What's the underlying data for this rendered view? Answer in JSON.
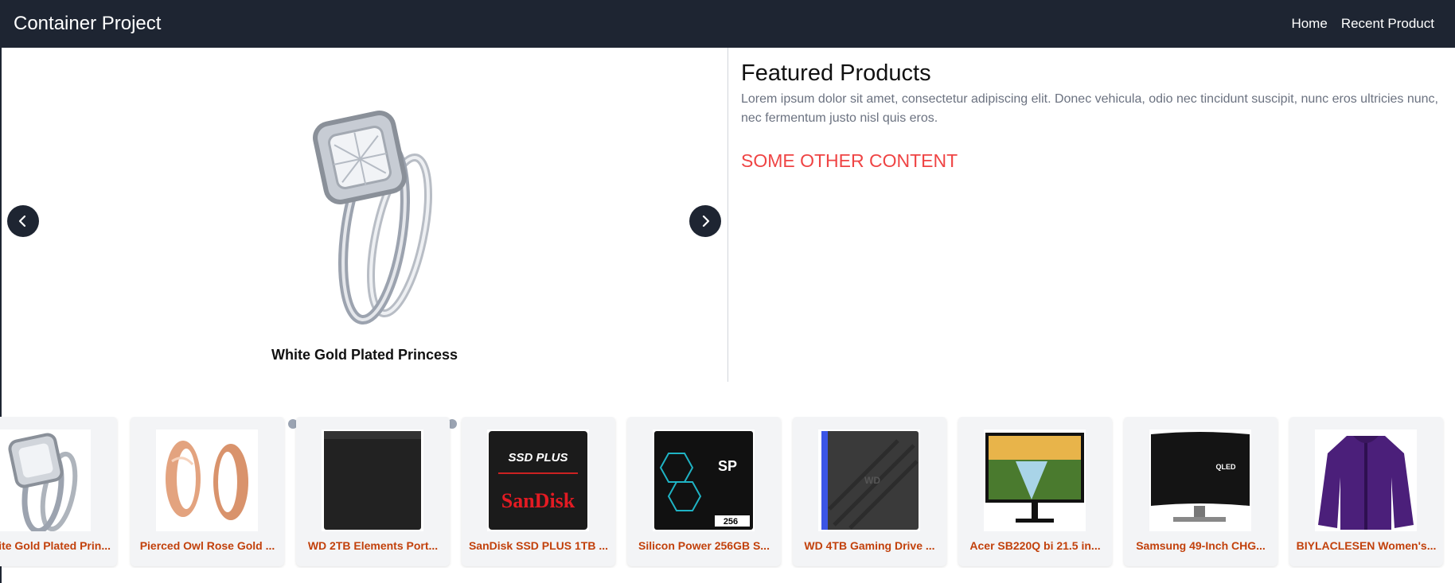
{
  "navbar": {
    "brand": "Container Project",
    "links": [
      "Home",
      "Recent Product"
    ]
  },
  "carousel": {
    "title": "White Gold Plated Princess",
    "dot_count": 20,
    "active_dot": 6
  },
  "featured": {
    "title": "Featured Products",
    "text": "Lorem ipsum dolor sit amet, consectetur adipiscing elit. Donec vehicula, odio nec tincidunt suscipit, nunc eros ultricies nunc, nec fermentum justo nisl quis eros.",
    "other": "SOME OTHER CONTENT"
  },
  "products": [
    "White Gold Plated Prin...",
    "Pierced Owl Rose Gold ...",
    "WD 2TB Elements Port...",
    "SanDisk SSD PLUS 1TB ...",
    "Silicon Power 256GB S...",
    "WD 4TB Gaming Drive ...",
    "Acer SB220Q bi 21.5 in...",
    "Samsung 49-Inch CHG...",
    "BIYLACLESEN Women's..."
  ],
  "colors": {
    "nav_bg": "#1e2532",
    "accent_red": "#ef4444",
    "product_label": "#c2410c"
  },
  "icons": {
    "prev": "chevron-left-icon",
    "next": "chevron-right-icon"
  }
}
